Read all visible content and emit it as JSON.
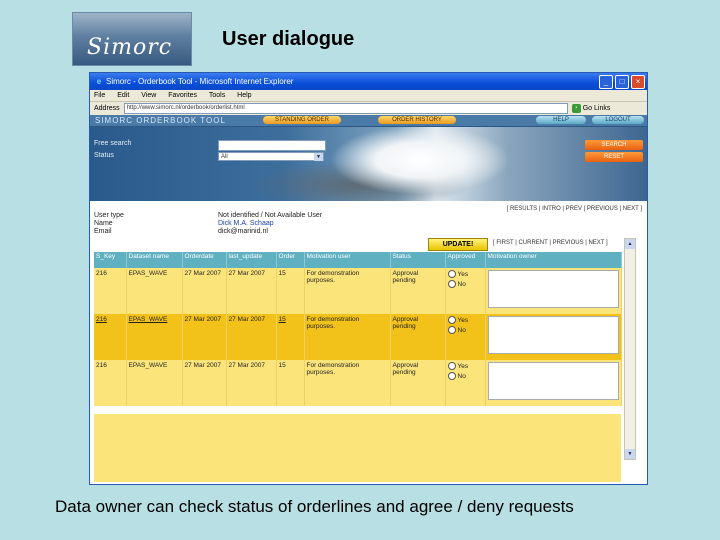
{
  "slide": {
    "logo_text": "Simorc",
    "title": "User dialogue",
    "caption": "Data owner can check status of orderlines and agree / deny requests"
  },
  "browser": {
    "window_title": "Simorc - Orderbook Tool - Microsoft Internet Explorer",
    "menu": [
      "File",
      "Edit",
      "View",
      "Favorites",
      "Tools",
      "Help"
    ],
    "address_label": "Address",
    "address": "http://www.simorc.nl/orderbook/orderlist.html",
    "go_label": "Go",
    "links_label": "Links"
  },
  "app": {
    "brand": "SIMORC ORDERBOOK TOOL",
    "nav": {
      "standing_order": "STANDING ORDER",
      "order_history": "ORDER HISTORY",
      "help": "HELP",
      "logout": "LOGOUT"
    },
    "search": {
      "free_search_label": "Free search",
      "status_label": "Status",
      "status_value": "All",
      "search_button": "SEARCH",
      "reset_button": "RESET"
    },
    "user": {
      "user_type_label": "User type",
      "name_label": "Name",
      "email_label": "Email",
      "user_type_value": "Not identified / Not Available User",
      "name_value": "Dick M.A. Schaap",
      "email_value": "dick@marinid.nl"
    },
    "pager_top": "[ RESULTS | INTRO | PREV | PREVIOUS | NEXT ]",
    "update_button": "UPDATE!",
    "pager_bottom": "[ FIRST | CURRENT | PREVIOUS | NEXT ]",
    "table": {
      "headers": [
        "S_Key",
        "Dataset name",
        "Orderdate",
        "last_update",
        "Order",
        "Motivation user",
        "Status",
        "Approved",
        "Motivation owner"
      ],
      "rows": [
        {
          "key": "216",
          "dataset": "EPAS_WAVE",
          "orderdate": "27 Mar 2007",
          "last_update": "27 Mar 2007",
          "order": "15",
          "motivation": "For demonstration purposes.",
          "status": "Approval pending",
          "yes": "Yes",
          "no": "No"
        },
        {
          "key": "216",
          "dataset": "EPAS_WAVE",
          "orderdate": "27 Mar 2007",
          "last_update": "27 Mar 2007",
          "order": "15",
          "motivation": "For demonstration purposes.",
          "status": "Approval pending",
          "yes": "Yes",
          "no": "No"
        },
        {
          "key": "216",
          "dataset": "EPAS_WAVE",
          "orderdate": "27 Mar 2007",
          "last_update": "27 Mar 2007",
          "order": "15",
          "motivation": "For demonstration purposes.",
          "status": "Approval pending",
          "yes": "Yes",
          "no": "No"
        }
      ]
    }
  }
}
